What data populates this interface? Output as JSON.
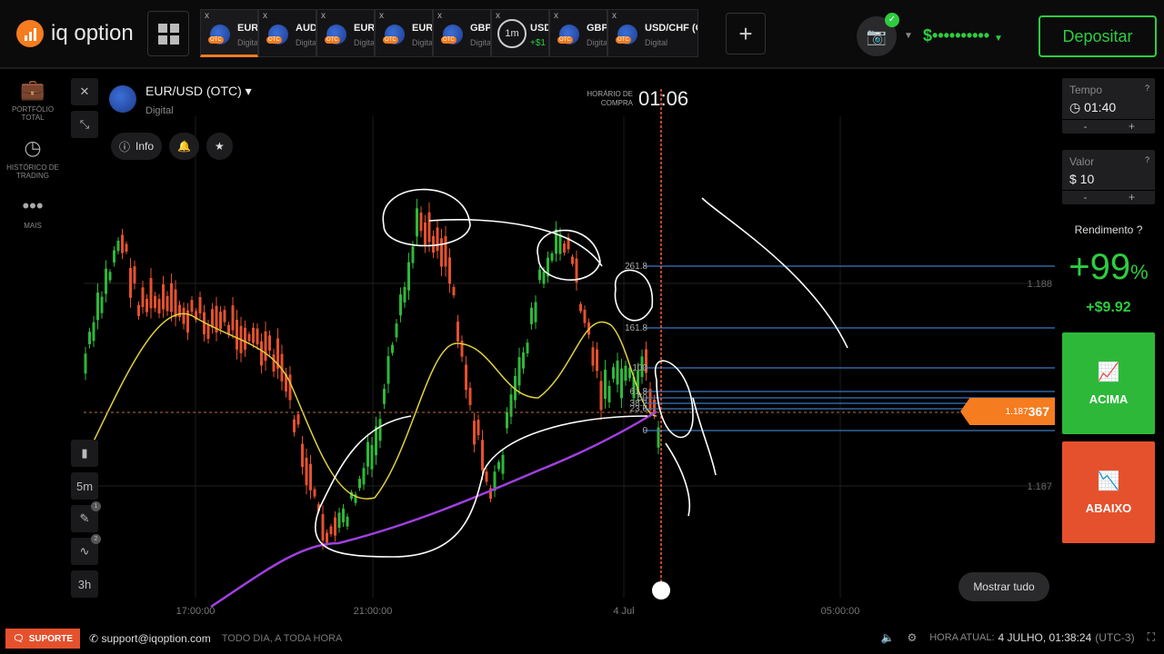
{
  "brand": {
    "name": "iq option",
    "accent": "#f57c1f"
  },
  "tabs": [
    {
      "name": "EUR",
      "sub": "Digital",
      "active": true
    },
    {
      "name": "AUD",
      "sub": "Digital"
    },
    {
      "name": "EUR",
      "sub": "Digital"
    },
    {
      "name": "EUR",
      "sub": "Digital"
    },
    {
      "name": "GBP",
      "sub": "Digital"
    },
    {
      "name": "USD",
      "timer": "1m",
      "gain": "+$1"
    },
    {
      "name": "GBP",
      "sub": "Digital"
    },
    {
      "name": "USD/CHF (O...",
      "sub": "Digital"
    }
  ],
  "header": {
    "balance": "$••••••••••",
    "deposit": "Depositar"
  },
  "leftnav": [
    {
      "label": "PORTFÓLIO TOTAL",
      "icon": "briefcase-icon",
      "badge": "1"
    },
    {
      "label": "HISTÓRICO DE TRADING",
      "icon": "history-icon"
    },
    {
      "label": "MAIS",
      "icon": "more-icon"
    }
  ],
  "tools": {
    "timeframe": "5m",
    "period": "3h",
    "draw_badge": "1",
    "indicator_badge": "2"
  },
  "asset": {
    "name": "EUR/USD (OTC)",
    "type": "Digital",
    "info": "Info"
  },
  "purchase": {
    "label": "HORÁRIO DE COMPRA",
    "time": "01:06"
  },
  "chart": {
    "price_labels": [
      "1.188",
      "1.187"
    ],
    "current_price_prefix": "1.187",
    "current_price_suffix": "367",
    "time_labels": [
      "17:00:00",
      "21:00:00",
      "4 Jul",
      "05:00:00"
    ],
    "fib_levels": [
      "261.8",
      "161.8",
      "100",
      "61.8",
      "50",
      "38.2",
      "23.6",
      "0"
    ],
    "show_all": "Mostrar tudo",
    "colors": {
      "up": "#2eb83a",
      "down": "#e5512c",
      "ma_fast": "#e0d040",
      "ma_slow": "#a040e0",
      "fib": "#3a78c0",
      "expiry": "#ff5a3a"
    }
  },
  "panel": {
    "time_label": "Tempo",
    "time_value": "01:40",
    "amount_label": "Valor",
    "amount_value": "$ 10",
    "yield_label": "Rendimento",
    "yield_pct": "+99",
    "yield_unit": "%",
    "profit": "+$9.92",
    "up_label": "ACIMA",
    "down_label": "ABAIXO"
  },
  "footer": {
    "support": "SUPORTE",
    "email": "support@iqoption.com",
    "hours": "TODO DIA, A TODA HORA",
    "clock_label": "HORA ATUAL:",
    "clock": "4 JULHO, 01:38:24",
    "tz": "(UTC-3)"
  }
}
